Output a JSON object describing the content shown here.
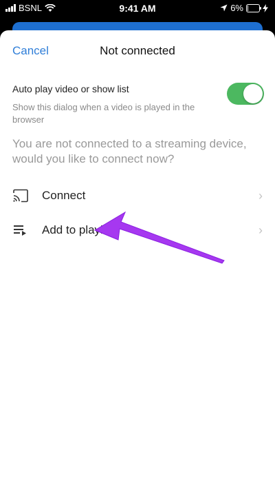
{
  "status_bar": {
    "carrier": "BSNL",
    "time": "9:41 AM",
    "battery": "6%",
    "battery_level": 0.06
  },
  "dialog": {
    "cancel_label": "Cancel",
    "title": "Not connected",
    "setting": {
      "title": "Auto play video or show list",
      "subtitle": "Show this dialog when a video is played in the browser",
      "toggle_on": true
    },
    "prompt": "You are not connected to a streaming device, would you like to connect now?",
    "options": [
      {
        "label": "Connect",
        "icon": "cast-icon"
      },
      {
        "label": "Add to playlist",
        "icon": "playlist-add-icon"
      }
    ]
  },
  "colors": {
    "accent": "#2f7ed8",
    "toggle_on": "#4cb860",
    "annotation_arrow": "#a638f0"
  }
}
